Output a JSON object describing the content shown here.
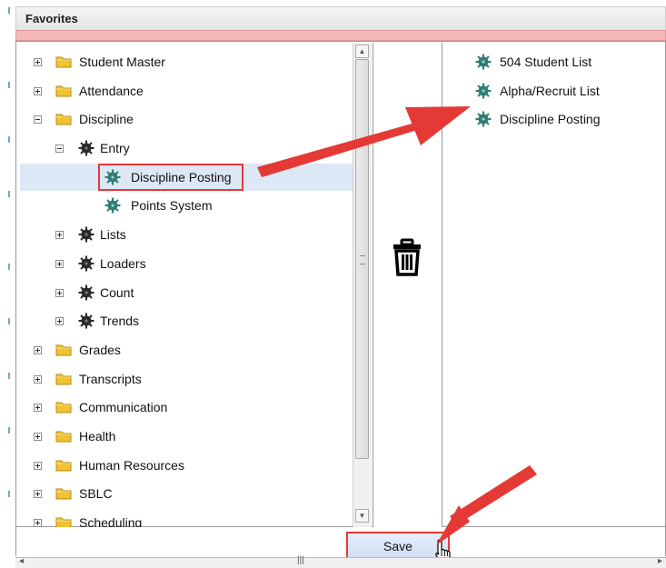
{
  "window": {
    "title": "Favorites"
  },
  "tree": {
    "items": [
      {
        "label": "Student Master",
        "toggle": "plus",
        "icon": "folder-icon"
      },
      {
        "label": "Attendance",
        "toggle": "plus",
        "icon": "folder-icon"
      },
      {
        "label": "Discipline",
        "toggle": "minus",
        "icon": "folder-icon"
      },
      {
        "label": "Entry",
        "toggle": "minus",
        "icon": "gear-icon"
      },
      {
        "label": "Discipline Posting",
        "toggle": "none",
        "icon": "gear-icon",
        "selected": true
      },
      {
        "label": "Points System",
        "toggle": "none",
        "icon": "gear-icon"
      },
      {
        "label": "Lists",
        "toggle": "plus",
        "icon": "gear-icon"
      },
      {
        "label": "Loaders",
        "toggle": "plus",
        "icon": "gear-icon"
      },
      {
        "label": "Count",
        "toggle": "plus",
        "icon": "gear-icon"
      },
      {
        "label": "Trends",
        "toggle": "plus",
        "icon": "gear-icon"
      },
      {
        "label": "Grades",
        "toggle": "plus",
        "icon": "folder-icon"
      },
      {
        "label": "Transcripts",
        "toggle": "plus",
        "icon": "folder-icon"
      },
      {
        "label": "Communication",
        "toggle": "plus",
        "icon": "folder-icon"
      },
      {
        "label": "Health",
        "toggle": "plus",
        "icon": "folder-icon"
      },
      {
        "label": "Human Resources",
        "toggle": "plus",
        "icon": "folder-icon"
      },
      {
        "label": "SBLC",
        "toggle": "plus",
        "icon": "folder-icon"
      },
      {
        "label": "Scheduling",
        "toggle": "plus",
        "icon": "folder-icon"
      }
    ]
  },
  "favorites": {
    "items": [
      {
        "label": "504 Student List",
        "icon": "gear-icon"
      },
      {
        "label": "Alpha/Recruit List",
        "icon": "gear-icon"
      },
      {
        "label": "Discipline Posting",
        "icon": "gear-icon"
      }
    ]
  },
  "middle": {
    "icon": "trash-icon"
  },
  "actions": {
    "save_label": "Save"
  },
  "colors": {
    "highlight": "#e53935",
    "selected_row": "#dde8f7",
    "folder": "#f2c230",
    "gear_dark": "#2a2a2a",
    "gear_teal": "#2f7d73"
  }
}
